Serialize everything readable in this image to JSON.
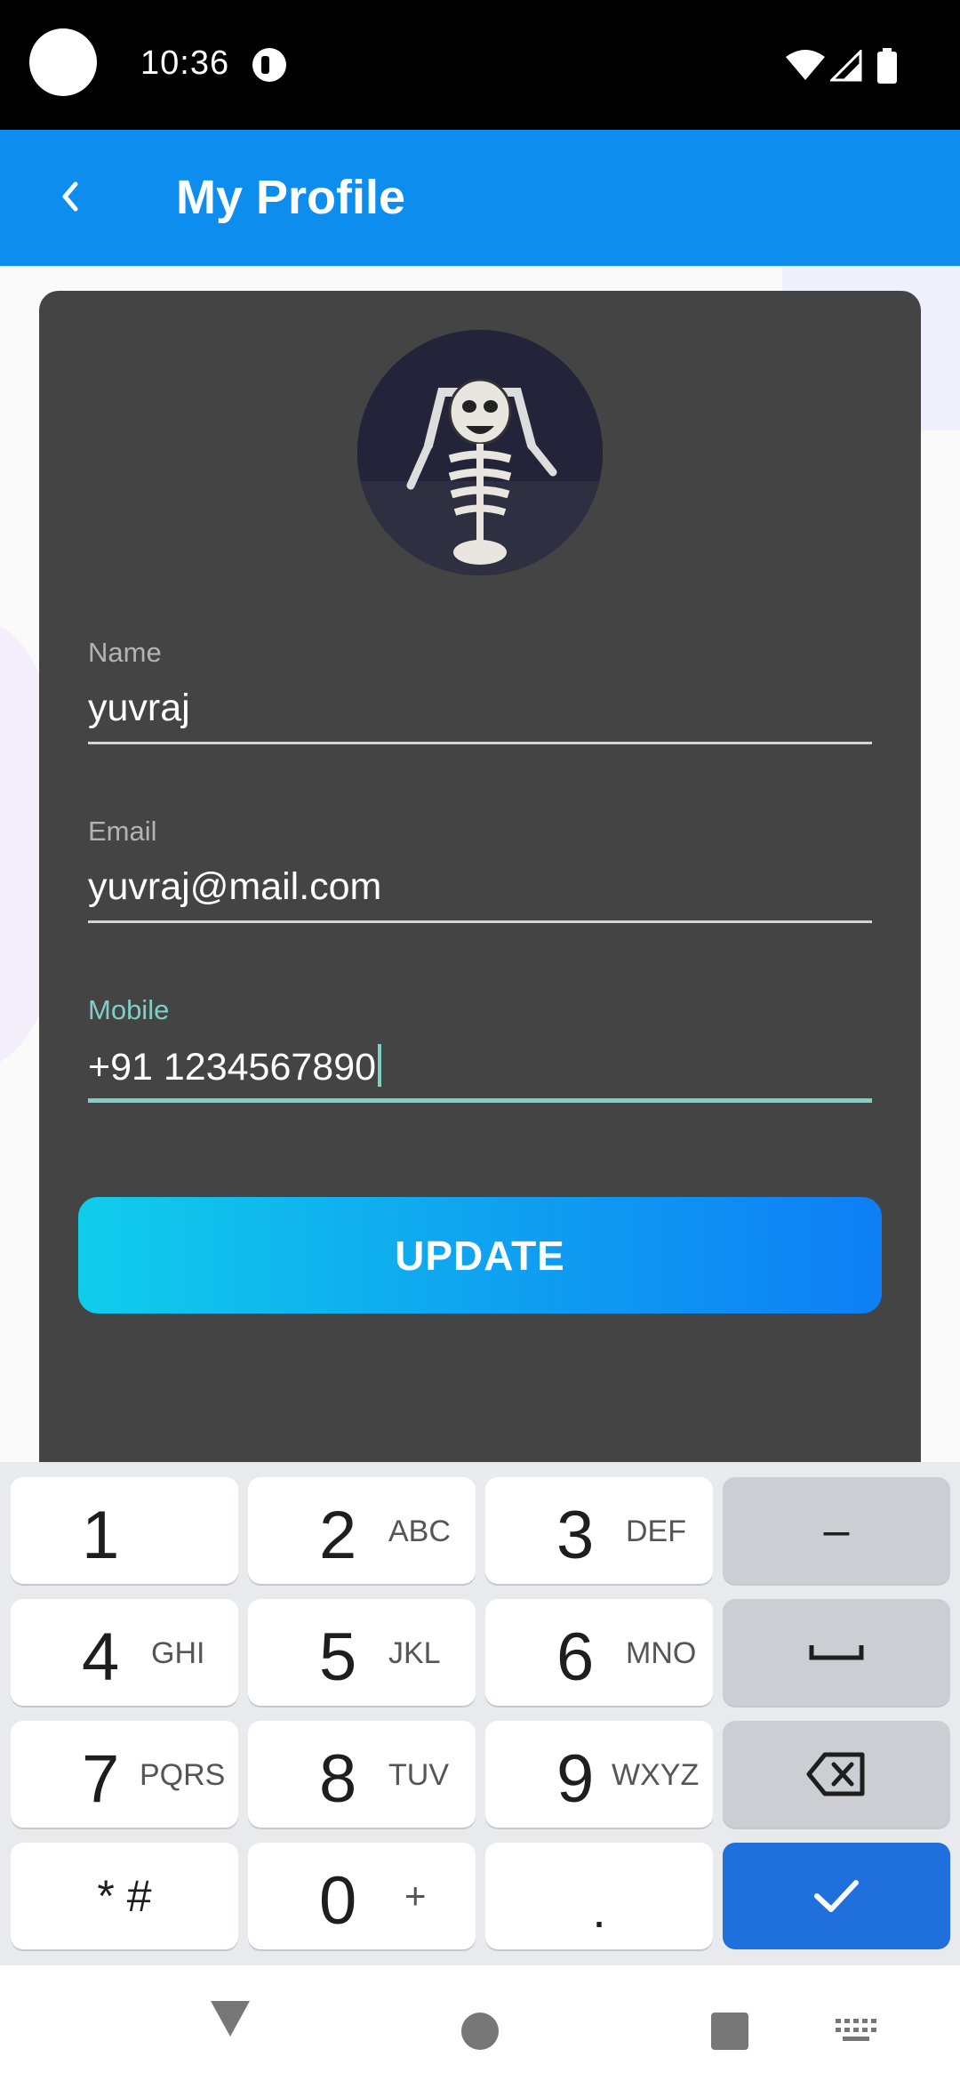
{
  "status_bar": {
    "time": "10:36",
    "icons": [
      "wifi-icon",
      "signal-icon",
      "battery-icon",
      "notification-icon"
    ]
  },
  "app_bar": {
    "title": "My Profile",
    "back_icon": "chevron-left-icon",
    "color": "#0d8eef"
  },
  "profile": {
    "avatar_icon": "skeleton-avatar",
    "fields": {
      "name": {
        "label": "Name",
        "value": "yuvraj"
      },
      "email": {
        "label": "Email",
        "value": "yuvraj@mail.com"
      },
      "mobile": {
        "label": "Mobile",
        "value": "+91 1234567890"
      }
    },
    "update_label": "UPDATE",
    "accent": "#7fcfc4",
    "card_color": "#444444"
  },
  "keyboard": {
    "keys": {
      "k1": {
        "digit": "1",
        "letters": ""
      },
      "k2": {
        "digit": "2",
        "letters": "ABC"
      },
      "k3": {
        "digit": "3",
        "letters": "DEF"
      },
      "k4": {
        "digit": "4",
        "letters": "GHI"
      },
      "k5": {
        "digit": "5",
        "letters": "JKL"
      },
      "k6": {
        "digit": "6",
        "letters": "MNO"
      },
      "k7": {
        "digit": "7",
        "letters": "PQRS"
      },
      "k8": {
        "digit": "8",
        "letters": "TUV"
      },
      "k9": {
        "digit": "9",
        "letters": "WXYZ"
      },
      "k0": {
        "digit": "0",
        "letters": "+"
      },
      "star": "* #",
      "dot": ".",
      "minus": "–"
    },
    "done_color": "#1f6fdd"
  }
}
